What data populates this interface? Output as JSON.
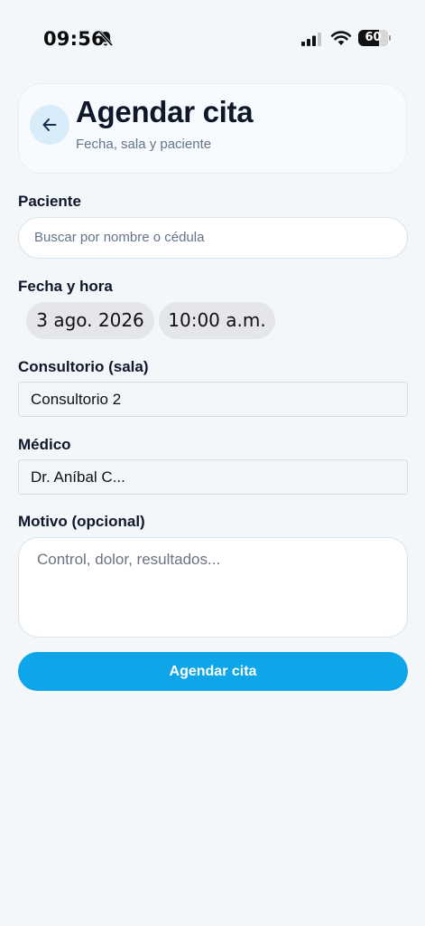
{
  "status_bar": {
    "time": "09:56",
    "battery": "60",
    "icons": [
      "bell-slash-icon",
      "cellular-signal-icon",
      "wifi-icon",
      "battery-icon"
    ]
  },
  "header": {
    "title": "Agendar cita",
    "subtitle": "Fecha, sala y paciente",
    "back_icon": "arrow-left-icon"
  },
  "form": {
    "patient": {
      "label": "Paciente",
      "placeholder": "Buscar por nombre o cédula"
    },
    "datetime": {
      "label": "Fecha y hora",
      "date": "3 ago. 2026",
      "time": "10:00 a.m."
    },
    "room": {
      "label": "Consultorio (sala)",
      "value": "Consultorio 2"
    },
    "doctor": {
      "label": "Médico",
      "value": "Dr. Aníbal C..."
    },
    "reason": {
      "label": "Motivo (opcional)",
      "placeholder": "Control, dolor, resultados..."
    },
    "submit_label": "Agendar cita"
  },
  "colors": {
    "background": "#f3f7fa",
    "accent": "#0ea5e9",
    "back_button_bg": "#d9ecfa"
  }
}
